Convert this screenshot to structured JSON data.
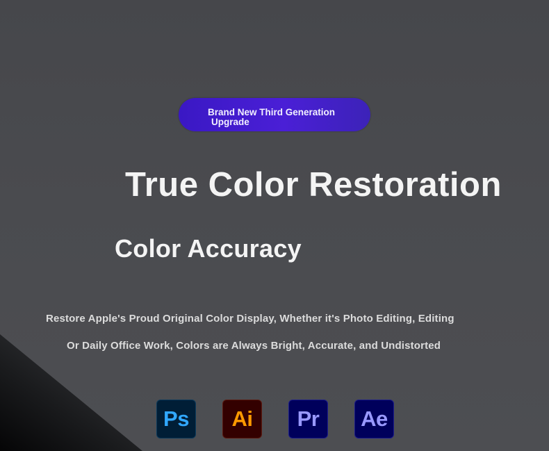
{
  "badge": {
    "line1": "Brand New Third Generation",
    "line2": "Upgrade"
  },
  "headline": "True Color Restoration",
  "subheadline": "Color Accuracy",
  "description": {
    "line1": "Restore Apple's Proud Original Color Display, Whether it's Photo Editing, Editing",
    "line2": "Or Daily Office Work, Colors are Always Bright, Accurate, and Undistorted"
  },
  "apps": [
    {
      "icon": "photoshop-icon",
      "label": "Ps",
      "bg": "#001e36",
      "fg": "#31a8ff"
    },
    {
      "icon": "illustrator-icon",
      "label": "Ai",
      "bg": "#330000",
      "fg": "#ff9a00"
    },
    {
      "icon": "premiere-pro-icon",
      "label": "Pr",
      "bg": "#00005b",
      "fg": "#9999ff"
    },
    {
      "icon": "after-effects-icon",
      "label": "Ae",
      "bg": "#00005b",
      "fg": "#9999ff"
    }
  ],
  "colors": {
    "background": "#4b4c50",
    "badge": "#4a1fd6",
    "text": "#f4f4f4"
  }
}
